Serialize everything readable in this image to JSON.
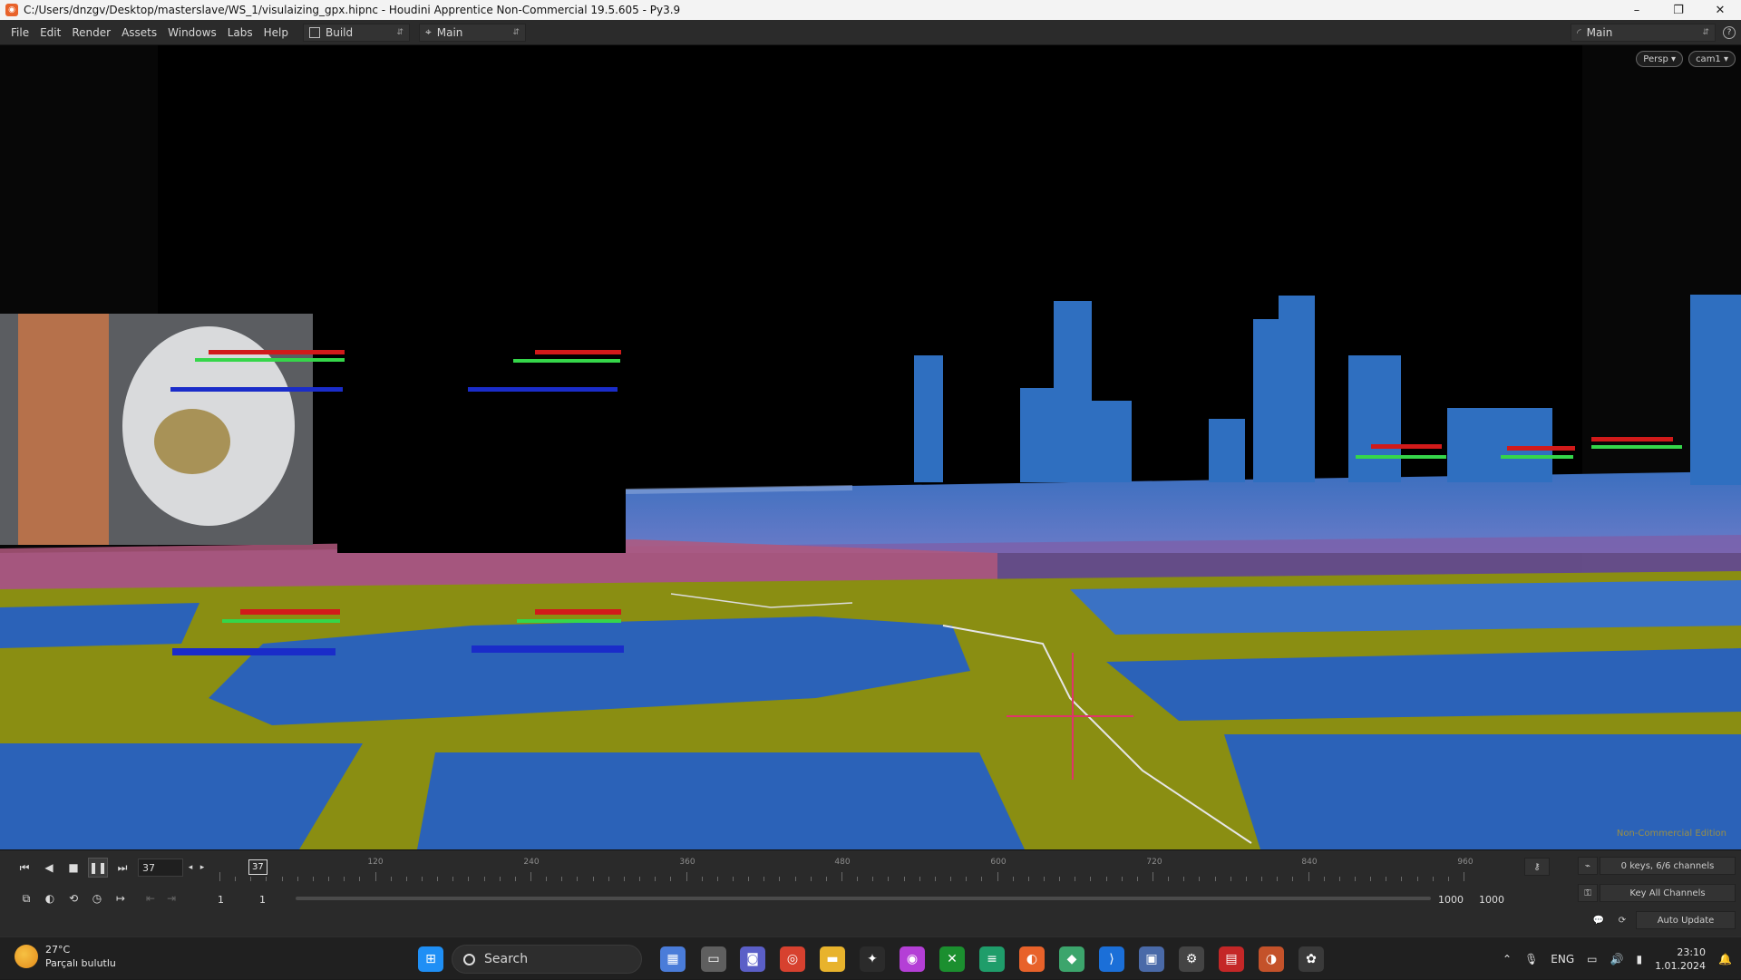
{
  "window": {
    "title": "C:/Users/dnzgv/Desktop/masterslave/WS_1/visulaizing_gpx.hipnc - Houdini Apprentice Non-Commercial 19.5.605 - Py3.9",
    "minimize": "–",
    "maximize": "❐",
    "close": "✕"
  },
  "menu": {
    "items": [
      "File",
      "Edit",
      "Render",
      "Assets",
      "Windows",
      "Labs",
      "Help"
    ],
    "desktop_label": "Build",
    "network_label": "Main",
    "right_label": "Main"
  },
  "viewport": {
    "persp_label": "Persp ▾",
    "cam_label": "cam1 ▾",
    "edition_label": "Non-Commercial Edition"
  },
  "timeline": {
    "current_frame": "37",
    "marker_frame": "37",
    "ruler_labels": [
      "120",
      "240",
      "360",
      "480",
      "600",
      "720",
      "840",
      "960"
    ],
    "start_frame": "1",
    "start_frame2": "1",
    "end_frame": "1000",
    "end_frame2": "1000",
    "keys_label": "0 keys, 6/6 channels",
    "key_all_label": "Key All Channels",
    "auto_update_label": "Auto Update"
  },
  "taskbar": {
    "weather_temp": "27°C",
    "weather_desc": "Parçalı bulutlu",
    "search_label": "Search",
    "lang": "ENG",
    "time": "23:10",
    "date": "1.01.2024"
  },
  "colors": {
    "ground_yellow": "#8a8e12",
    "ground_blue": "#2b62b8",
    "buildings": "#2f6fc0",
    "pink": "#b0587c"
  }
}
